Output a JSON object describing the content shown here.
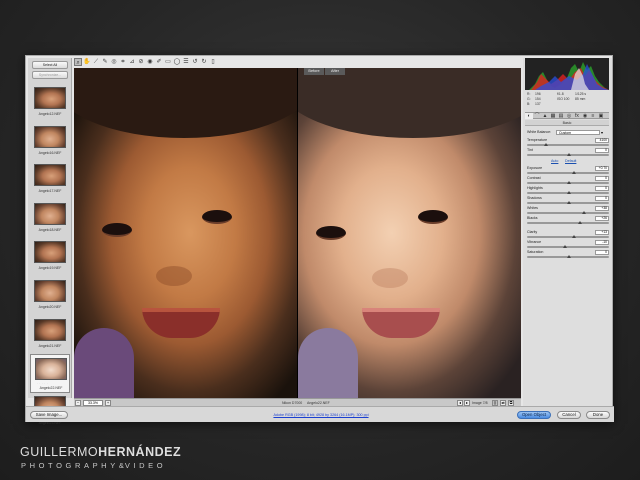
{
  "filmstrip": {
    "select_all": "Select All",
    "synchronize": "Synchronize...",
    "items": [
      {
        "label": "Angelo12.NEF",
        "selected": false
      },
      {
        "label": "Angelo16.NEF",
        "selected": false
      },
      {
        "label": "Angelo17.NEF",
        "selected": false
      },
      {
        "label": "Angelo18.NEF",
        "selected": false
      },
      {
        "label": "Angelo19.NEF",
        "selected": false
      },
      {
        "label": "Angelo20.NEF",
        "selected": false
      },
      {
        "label": "Angelo21.NEF",
        "selected": false
      },
      {
        "label": "Angelo22.NEF",
        "selected": true
      },
      {
        "label": "Angelo23.NEF",
        "selected": false
      }
    ],
    "stars": "· · · · ·"
  },
  "toolbar": {
    "tools": [
      "zoom-icon",
      "hand-icon",
      "white-balance-icon",
      "color-sampler-icon",
      "target-adjust-icon",
      "crop-icon",
      "straighten-icon",
      "spot-removal-icon",
      "red-eye-icon",
      "adjustment-brush-icon",
      "graduated-filter-icon",
      "radial-filter-icon",
      "preferences-icon",
      "rotate-left-icon",
      "rotate-right-icon",
      "trash-icon"
    ]
  },
  "preview": {
    "before_label": "Before",
    "after_label": "After"
  },
  "statusbar": {
    "zoom": "33.3%",
    "camera": "Nikon D7000",
    "filename": "Angelo22.NEF",
    "image_count": "Image 7/8"
  },
  "histogram": {
    "r": "R:",
    "r_val": "196",
    "g": "G:",
    "g_val": "154",
    "b": "B:",
    "b_val": "137",
    "aperture": "f/1.8",
    "shutter": "1/125 s",
    "iso": "ISO 100",
    "focal": "85 mm"
  },
  "basic_panel": {
    "title": "Basic",
    "white_balance_label": "White Balance:",
    "white_balance_value": "Custom",
    "temperature_label": "Temperature",
    "temperature_value": "4100",
    "tint_label": "Tint",
    "tint_value": "0",
    "auto": "Auto",
    "default": "Default",
    "exposure_label": "Exposure",
    "exposure_value": "+0.70",
    "contrast_label": "Contrast",
    "contrast_value": "0",
    "highlights_label": "Highlights",
    "highlights_value": "0",
    "shadows_label": "Shadows",
    "shadows_value": "0",
    "whites_label": "Whites",
    "whites_value": "+38",
    "blacks_label": "Blacks",
    "blacks_value": "+26",
    "clarity_label": "Clarity",
    "clarity_value": "+13",
    "vibrance_label": "Vibrance",
    "vibrance_value": "-10",
    "saturation_label": "Saturation",
    "saturation_value": "0"
  },
  "bottombar": {
    "save_image": "Save Image...",
    "workflow_link": "Adobe RGB (1998); 8 bit; 4928 by 3264 (16.1MP); 300 ppi",
    "open_object": "Open Object",
    "cancel": "Cancel",
    "done": "Done"
  },
  "brand": {
    "first": "GUILLERMO",
    "last": "HERNÁNDEZ",
    "sub_left": "PHOTOGRAPHY",
    "sub_amp": "&",
    "sub_right": "VIDEO"
  },
  "colors": {
    "accent_button": "#4a8be0",
    "link": "#1a4fb0"
  }
}
